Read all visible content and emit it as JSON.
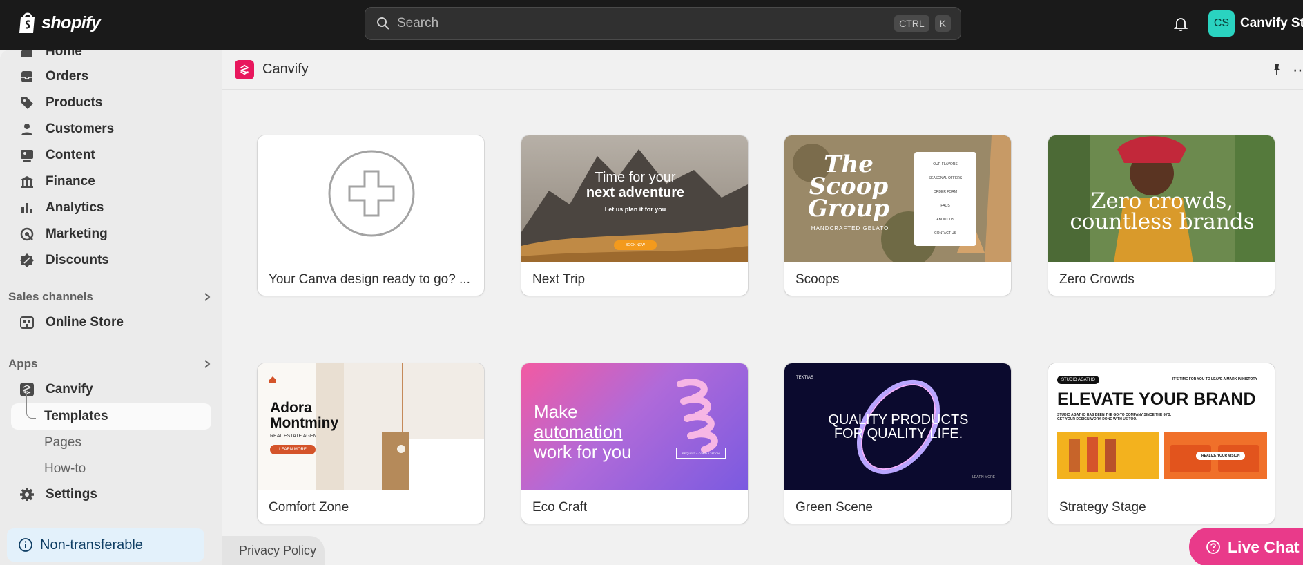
{
  "topbar": {
    "logo_text": "shopify",
    "search_placeholder": "Search",
    "kbd_ctrl": "CTRL",
    "kbd_k": "K",
    "avatar_initials": "CS",
    "store_name": "Canvify Store"
  },
  "sidebar": {
    "items": [
      {
        "label": "Home",
        "icon": "home-icon"
      },
      {
        "label": "Orders",
        "icon": "inbox-icon"
      },
      {
        "label": "Products",
        "icon": "tag-icon"
      },
      {
        "label": "Customers",
        "icon": "person-icon"
      },
      {
        "label": "Content",
        "icon": "image-icon"
      },
      {
        "label": "Finance",
        "icon": "bank-icon"
      },
      {
        "label": "Analytics",
        "icon": "bar-chart-icon"
      },
      {
        "label": "Marketing",
        "icon": "target-icon"
      },
      {
        "label": "Discounts",
        "icon": "discount-icon"
      }
    ],
    "sales_channels_heading": "Sales channels",
    "online_store_label": "Online Store",
    "apps_heading": "Apps",
    "canvify_label": "Canvify",
    "sub_items": [
      "Templates",
      "Pages",
      "How-to"
    ],
    "settings_label": "Settings",
    "non_transferable_label": "Non-transferable"
  },
  "app": {
    "title": "Canvify",
    "cards": [
      {
        "label": "Your Canva design ready to go? ..."
      },
      {
        "label": "Next Trip",
        "thumb_heading_1": "Time for your",
        "thumb_heading_2": "next adventure",
        "thumb_sub": "Let us plan it for you",
        "thumb_button": "BOOK NOW"
      },
      {
        "label": "Scoops",
        "thumb_heading": "The Scoop Group",
        "thumb_sub": "HANDCRAFTED GELATO",
        "thumb_menu": [
          "OUR FLAVORS",
          "SEASONAL OFFERS",
          "ORDER FORM",
          "FAQS",
          "ABOUT US",
          "CONTACT US"
        ]
      },
      {
        "label": "Zero Crowds",
        "thumb_heading_1": "Zero crowds,",
        "thumb_heading_2": "countless brands"
      },
      {
        "label": "Comfort Zone",
        "thumb_heading_1": "Adora",
        "thumb_heading_2": "Montminy",
        "thumb_sub": "REAL ESTATE AGENT",
        "thumb_button": "LEARN MORE"
      },
      {
        "label": "Eco Craft",
        "thumb_heading_1": "Make",
        "thumb_heading_2": "automation",
        "thumb_heading_3": "work for you",
        "thumb_button": "REQUEST A CONSULTATION"
      },
      {
        "label": "Green Scene",
        "thumb_brand": "TEKTIAS",
        "thumb_heading_1": "QUALITY PRODUCTS",
        "thumb_heading_2": "FOR QUALITY LIFE.",
        "thumb_link": "LEARN MORE"
      },
      {
        "label": "Strategy Stage",
        "thumb_brand": "STUDIO AGATHO",
        "thumb_tagline": "IT'S TIME FOR YOU TO LEAVE A MARK IN HISTORY",
        "thumb_heading": "ELEVATE YOUR BRAND",
        "thumb_sub_1": "STUDIO AGATHO HAS BEEN THE GO-TO COMPANY SINCE THE 80'S.",
        "thumb_sub_2": "GET YOUR DESIGN WORK DONE WITH US TOO.",
        "thumb_button": "REALIZE YOUR VISION"
      }
    ]
  },
  "footer": {
    "privacy_label": "Privacy Policy",
    "live_chat_label": "Live Chat"
  },
  "colors": {
    "topbar": "#1a1a1a",
    "accent_pink": "#e93a8a",
    "avatar": "#2ad3c0"
  }
}
